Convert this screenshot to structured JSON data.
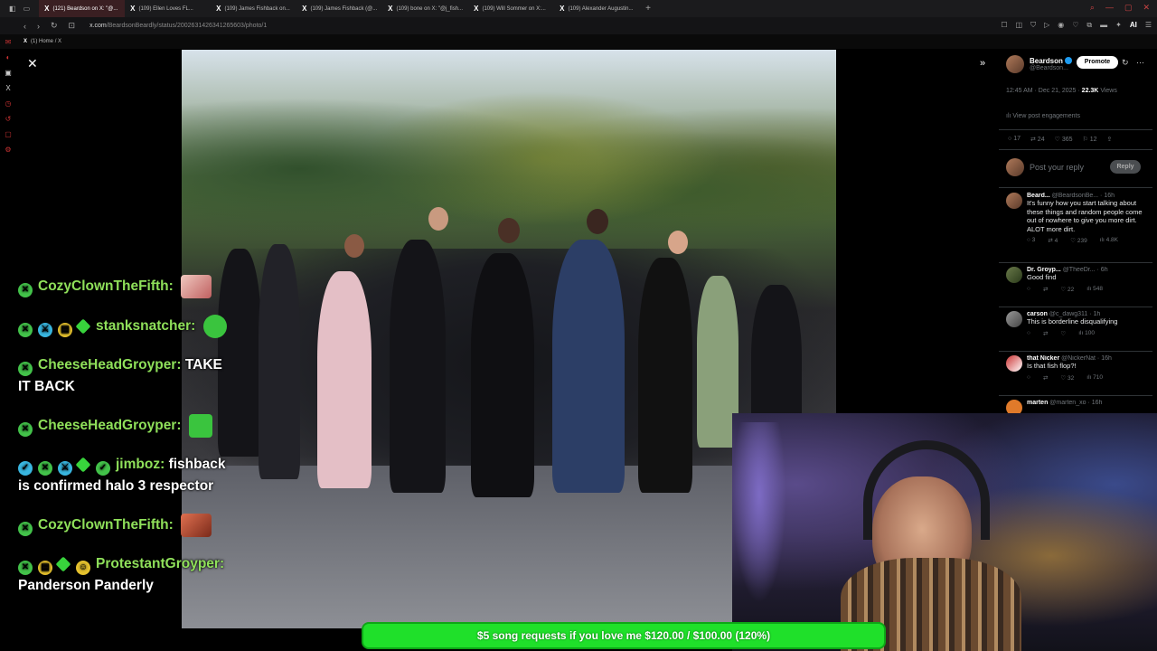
{
  "browser": {
    "tabs": [
      {
        "label": "(121) Beardson on X: \"@..."
      },
      {
        "label": "(109) Ellen Loves FL..."
      },
      {
        "label": "(109) James Fishback on..."
      },
      {
        "label": "(109) James Fishback (@..."
      },
      {
        "label": "(109) bone on X: \"@j_fish..."
      },
      {
        "label": "(109) Will Sommer on X:..."
      },
      {
        "label": "(109) Alexander Augustin..."
      }
    ],
    "url_host": "x.com",
    "url_path": "/BeardsonBeardly/status/2002631426341265603/photo/1",
    "ext_ai": "AI",
    "bookmark": "(1) Home / X"
  },
  "post": {
    "name": "Beardson",
    "handle": "@Beardson...",
    "promote_label": "Promote",
    "time": "12:45 AM · Dec 21, 2025 ·",
    "views_count": "22.3K",
    "views_label": "Views",
    "engagements_label": "View post engagements",
    "stats": {
      "replies": "17",
      "reposts": "24",
      "likes": "365",
      "bookmarks": "12"
    },
    "reply_placeholder": "Post your reply",
    "reply_button": "Reply"
  },
  "replies": [
    {
      "name": "Beard...",
      "handle": "@BeardsonBe... · 16h",
      "text": "It's funny how you start talking about these things and random people come out of nowhere to give you more dirt. ALOT more dirt.",
      "stats": [
        "3",
        "4",
        "239",
        "4.8K"
      ]
    },
    {
      "name": "Dr. Groyp...",
      "handle": "@TheeDr... · 6h",
      "text": "Good find",
      "stats": [
        "",
        "",
        "22",
        "548"
      ]
    },
    {
      "name": "carson",
      "handle": "@c_dawg311 · 1h",
      "text": "This is borderline disqualifying",
      "stats": [
        "",
        "",
        "",
        "100"
      ]
    },
    {
      "name": "that Nicker",
      "handle": "@NickerNat · 16h",
      "text": "Is that fish flop?!",
      "stats": [
        "",
        "",
        "32",
        "710"
      ]
    },
    {
      "name": "marten",
      "handle": "@marten_xo · 16h",
      "text": "",
      "stats": []
    }
  ],
  "chat": [
    {
      "user": "CozyClownTheFifth:",
      "text": ""
    },
    {
      "user": "stanksnatcher:",
      "text": ""
    },
    {
      "user": "CheeseHeadGroyper:",
      "text": "TAKE IT BACK"
    },
    {
      "user": "CheeseHeadGroyper:",
      "text": ""
    },
    {
      "user": "jimboz:",
      "text": "fishback is confirmed halo 3 respector"
    },
    {
      "user": "CozyClownTheFifth:",
      "text": ""
    },
    {
      "user": "ProtestantGroyper:",
      "text": "Panderson Panderly"
    }
  ],
  "goal": {
    "text": "$5 song requests if you love me $120.00 / $100.00 (120%)"
  },
  "colors": {
    "goal_green": "#1fe02a",
    "chat_user": "#8fe05a",
    "x_blue": "#1d9bf0"
  }
}
